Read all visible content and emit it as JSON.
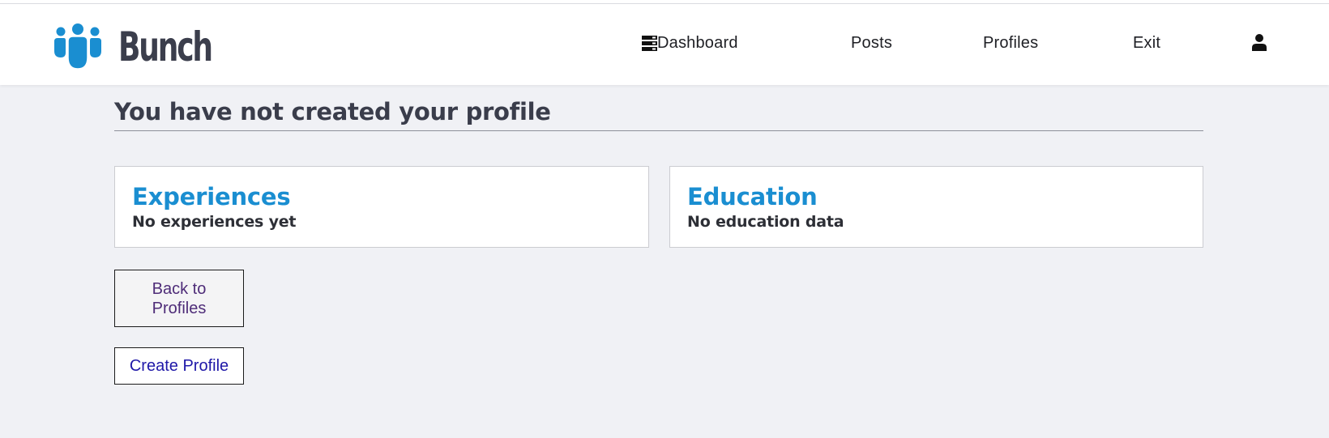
{
  "app": {
    "brand_name": "Bunch",
    "brand_color": "#1a8ed1",
    "logo_icon": "people-group-icon"
  },
  "nav": {
    "dashboard": {
      "label": "Dashboard",
      "icon": "dashboard-icon"
    },
    "posts": {
      "label": "Posts"
    },
    "profiles": {
      "label": "Profiles"
    },
    "exit": {
      "label": "Exit"
    },
    "user_icon": "user-icon"
  },
  "main": {
    "title": "You have not created your profile",
    "experiences": {
      "title": "Experiences",
      "empty_text": "No experiences yet"
    },
    "education": {
      "title": "Education",
      "empty_text": "No education data"
    },
    "buttons": {
      "back_label": "Back to Profiles",
      "create_label": "Create Profile"
    }
  },
  "colors": {
    "background": "#f0f1f5",
    "heading": "#3a3d4b",
    "accent": "#1a8ed1",
    "back_button_text": "#4e2c78",
    "create_button_text": "#1f18a8"
  }
}
